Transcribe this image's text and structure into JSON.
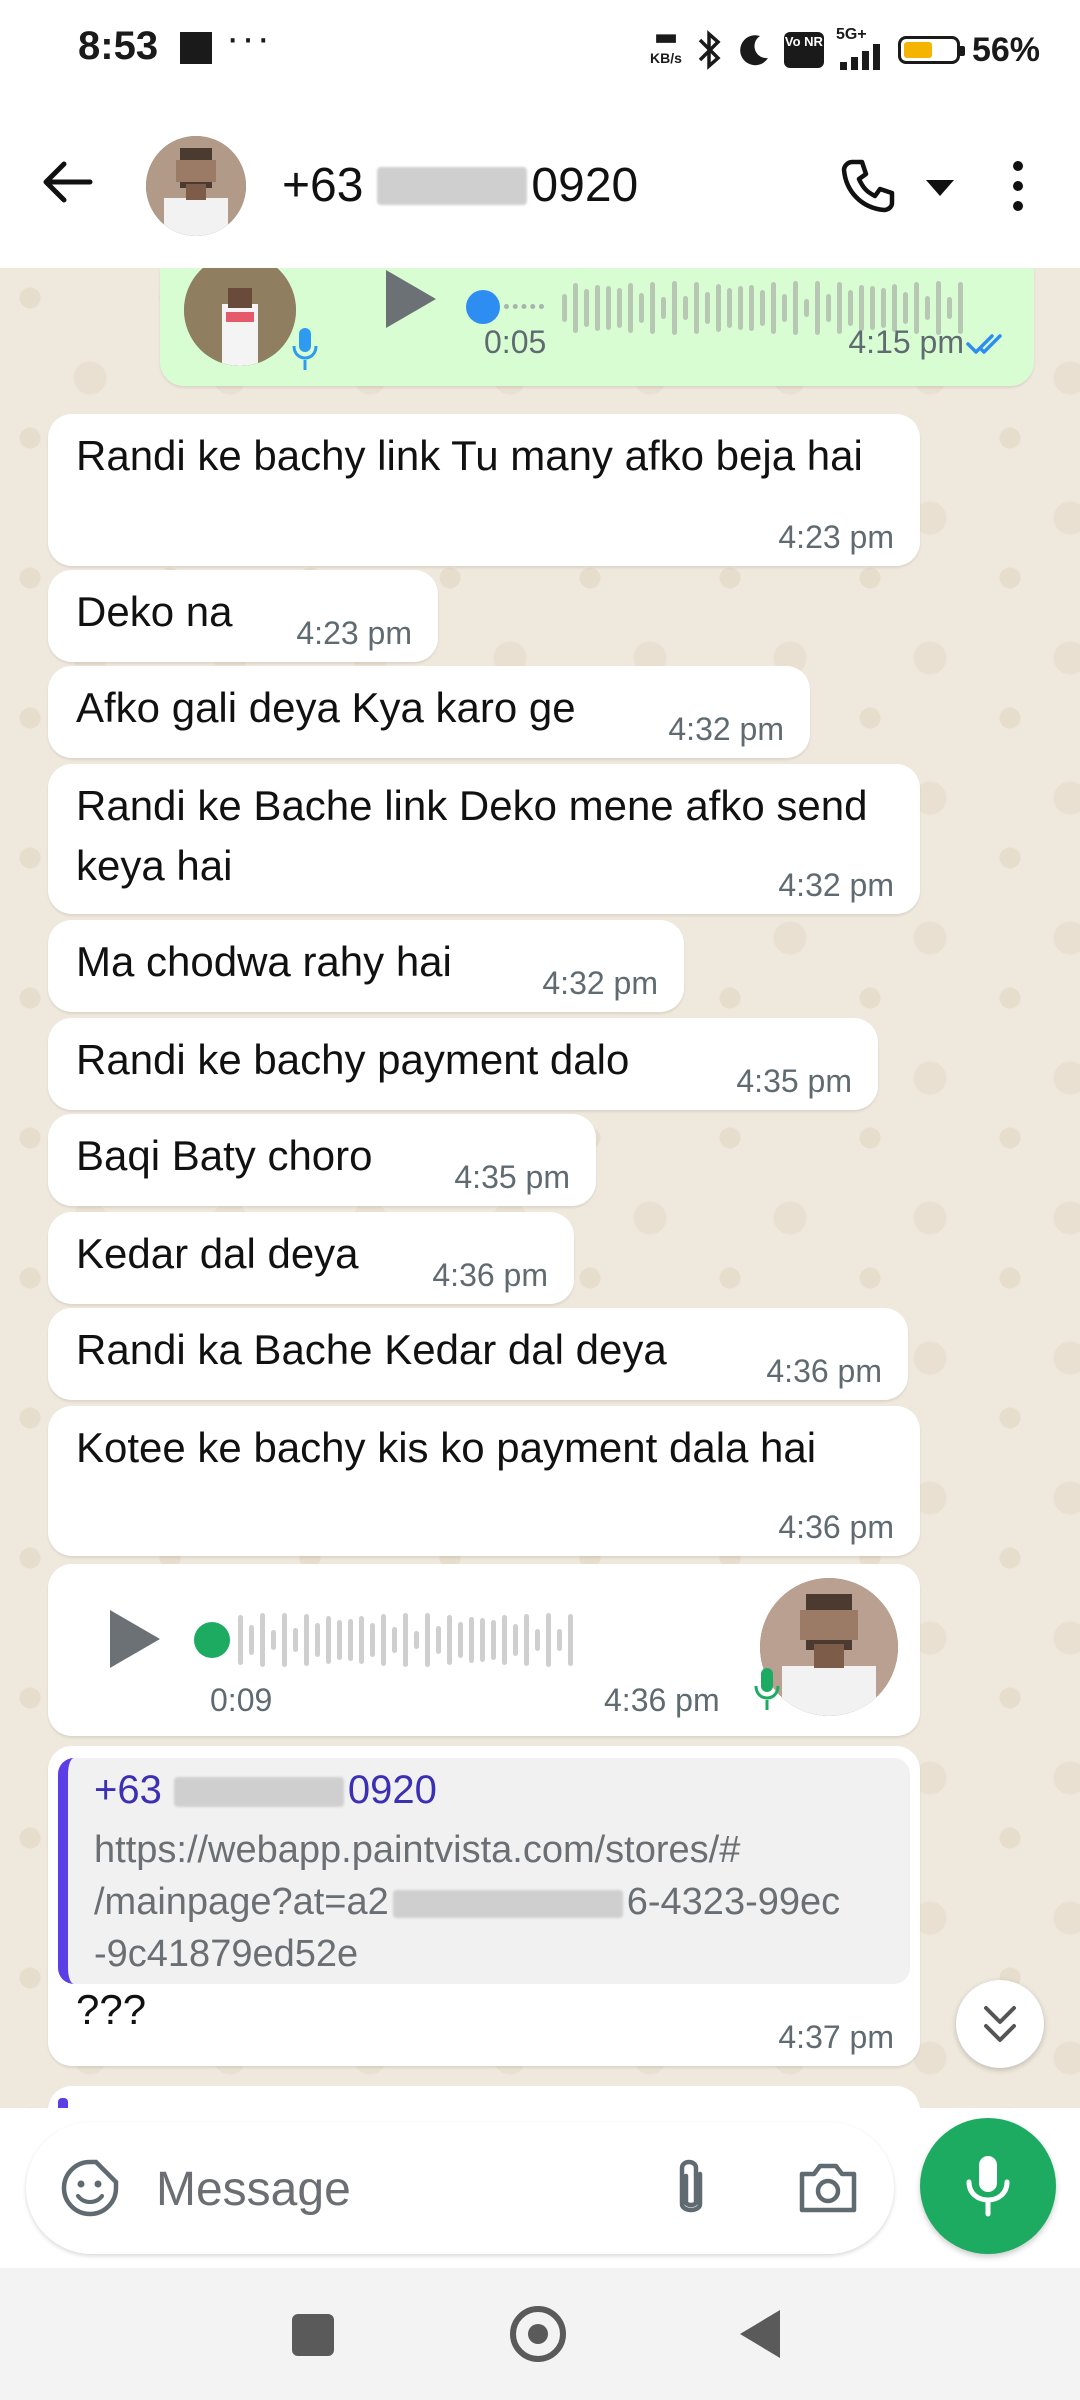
{
  "status_bar": {
    "time": "8:53",
    "dots": "···",
    "kbs": "KB/s",
    "network": "5G+",
    "volte": "Vo NR",
    "battery_percent": "56%",
    "battery_level": 0.56
  },
  "header": {
    "contact_prefix": "+63",
    "contact_suffix": "0920"
  },
  "messages": [
    {
      "kind": "voice-sent",
      "duration": "0:05",
      "time": "4:15 pm"
    },
    {
      "text": "Randi ke bachy link Tu many afko beja hai",
      "time": "4:23 pm"
    },
    {
      "text": "Deko na",
      "time": "4:23 pm"
    },
    {
      "text": "Afko gali deya Kya karo ge",
      "time": "4:32 pm"
    },
    {
      "text": "Randi ke Bache link Deko mene afko send keya hai",
      "time": "4:32 pm"
    },
    {
      "text": "Ma chodwa rahy hai",
      "time": "4:32 pm"
    },
    {
      "text": "Randi ke bachy payment dalo",
      "time": "4:35 pm"
    },
    {
      "text": "Baqi Baty choro",
      "time": "4:35 pm"
    },
    {
      "text": "Kedar dal deya",
      "time": "4:36 pm"
    },
    {
      "text": "Randi ka Bache Kedar dal deya",
      "time": "4:36 pm"
    },
    {
      "text": "Kotee ke bachy kis ko payment dala hai",
      "time": "4:36 pm"
    },
    {
      "kind": "voice-received",
      "duration": "0:09",
      "time": "4:36 pm"
    },
    {
      "kind": "reply",
      "quote_name_prefix": "+63",
      "quote_name_suffix": "0920",
      "quote_url_line1": "https://webapp.paintvista.com/stores/#",
      "quote_url_line2_prefix": "/mainpage?at=a2",
      "quote_url_line2_suffix": "6-4323-99ec",
      "quote_url_line3": "-9c41879ed52e",
      "text": "???",
      "time": "4:37 pm"
    }
  ],
  "input": {
    "placeholder": "Message"
  },
  "colors": {
    "accent": "#1dab61",
    "sent_bubble": "#d9fdd3",
    "wallpaper": "#efe8dc",
    "quote_bar": "#5b3ee6"
  },
  "icons": [
    "back-arrow-icon",
    "phone-icon",
    "more-vert-icon",
    "play-icon",
    "mic-icon",
    "double-check-icon",
    "emoji-icon",
    "attach-icon",
    "camera-icon",
    "chevrons-down-icon"
  ]
}
